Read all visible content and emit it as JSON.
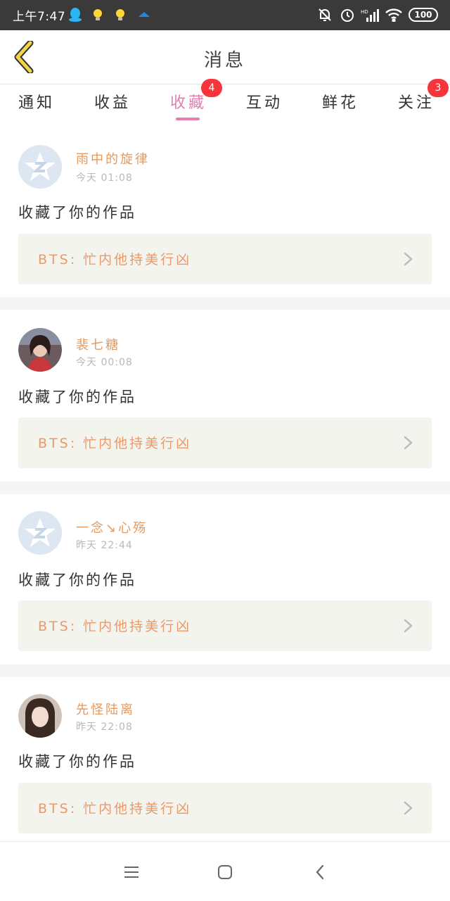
{
  "status_bar": {
    "time": "上午7:47",
    "battery": "100",
    "icons": [
      "qq-icon",
      "lightbulb-icon",
      "lightbulb-icon",
      "cloud-icon",
      "bell-off-icon",
      "alarm-icon",
      "hd-signal-icon",
      "wifi-icon",
      "battery-icon"
    ]
  },
  "header": {
    "title": "消息",
    "back_icon": "back-chevron-icon"
  },
  "tabs": [
    {
      "label": "通知",
      "badge": ""
    },
    {
      "label": "收益",
      "badge": ""
    },
    {
      "label": "收藏",
      "badge": "4",
      "active": true
    },
    {
      "label": "互动",
      "badge": ""
    },
    {
      "label": "鲜花",
      "badge": ""
    },
    {
      "label": "关注",
      "badge": "3"
    }
  ],
  "colors": {
    "accent": "#e07fb0",
    "username": "#e39a61",
    "badge": "#f5343c",
    "work_bg": "#f4f4ef"
  },
  "messages": [
    {
      "user": "雨中的旋律",
      "time": "今天 01:08",
      "action": "收藏了你的作品",
      "work": "BTS: 忙内他持美行凶",
      "avatar": "default"
    },
    {
      "user": "裴七糖",
      "time": "今天 00:08",
      "action": "收藏了你的作品",
      "work": "BTS: 忙内他持美行凶",
      "avatar": "photo"
    },
    {
      "user": "一念↘心殇",
      "time": "昨天 22:44",
      "action": "收藏了你的作品",
      "work": "BTS: 忙内他持美行凶",
      "avatar": "default"
    },
    {
      "user": "先怪陆离",
      "time": "昨天 22:08",
      "action": "收藏了你的作品",
      "work": "BTS: 忙内他持美行凶",
      "avatar": "photo"
    }
  ],
  "nav": [
    "menu-icon",
    "home-square-icon",
    "back-icon"
  ]
}
